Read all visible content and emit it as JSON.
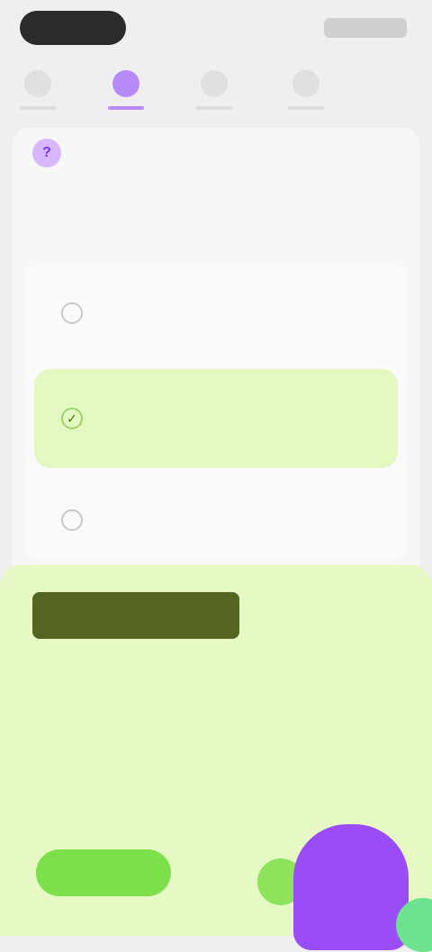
{
  "topbar": {
    "left_button": "",
    "right_label": ""
  },
  "tabs": [
    {
      "label": "",
      "active": false
    },
    {
      "label": "",
      "active": true
    },
    {
      "label": "",
      "active": false
    },
    {
      "label": "",
      "active": false
    }
  ],
  "question": {
    "icon": "?",
    "text": ""
  },
  "options": [
    {
      "text": "",
      "state": "default"
    },
    {
      "text": "",
      "state": "correct"
    },
    {
      "text": "",
      "state": "default"
    }
  ],
  "feedback": {
    "headline": "",
    "why_label": "",
    "explanation": "",
    "continue_label": "",
    "mascot_label": ""
  },
  "colors": {
    "accent_purple": "#9a4cf7",
    "correct_green_bg": "#e4f8c2",
    "sheet_bg": "#e6f9c4",
    "button_green": "#7be04a"
  }
}
